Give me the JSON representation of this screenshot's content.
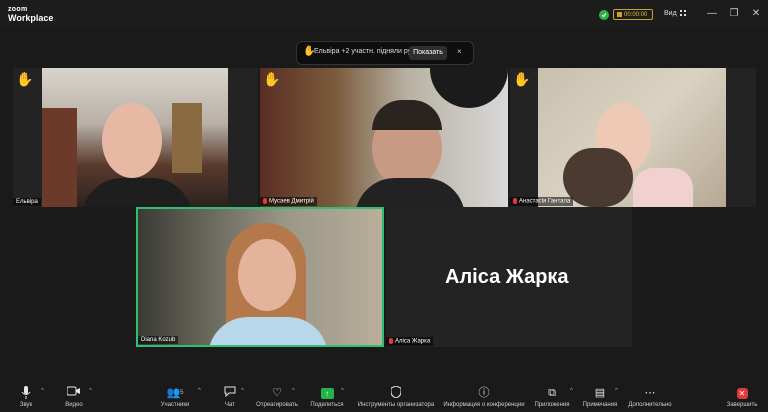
{
  "app": {
    "logo_line1": "zoom",
    "logo_line2": "Workplace"
  },
  "titlebar": {
    "timer": "00:00:00",
    "view_label": "Вид",
    "minimize": "—",
    "restore": "❐",
    "close": "✕"
  },
  "notification": {
    "text": "Ельвіра +2 участн. підняли руку",
    "show_button": "Показать",
    "close": "×"
  },
  "participants": [
    {
      "name": "Ельвіра",
      "hand_raised": true,
      "muted": false
    },
    {
      "name": "Мусаев Дмитрій",
      "hand_raised": true,
      "muted": true
    },
    {
      "name": "Анастасія Гантала",
      "hand_raised": true,
      "muted": true
    },
    {
      "name": "Diana Kozub",
      "hand_raised": false,
      "muted": false,
      "active_speaker": true
    },
    {
      "name": "Аліса Жарка",
      "hand_raised": false,
      "muted": true,
      "video_off": true
    }
  ],
  "toolbar": {
    "audio": "Звук",
    "video": "Видео",
    "participants": "Участники",
    "participants_count": "5",
    "chat": "Чат",
    "react": "Отреагировать",
    "share": "Поделиться",
    "host_tools": "Инструменты организатора",
    "info": "Информация о конференции",
    "apps": "Приложения",
    "notes": "Примечания",
    "more": "Дополнительно",
    "end": "Завершить"
  },
  "colors": {
    "active_speaker_border": "#2fbf71",
    "share_green": "#22b34a",
    "end_red": "#e0393e",
    "mute_red": "#e0393e"
  }
}
